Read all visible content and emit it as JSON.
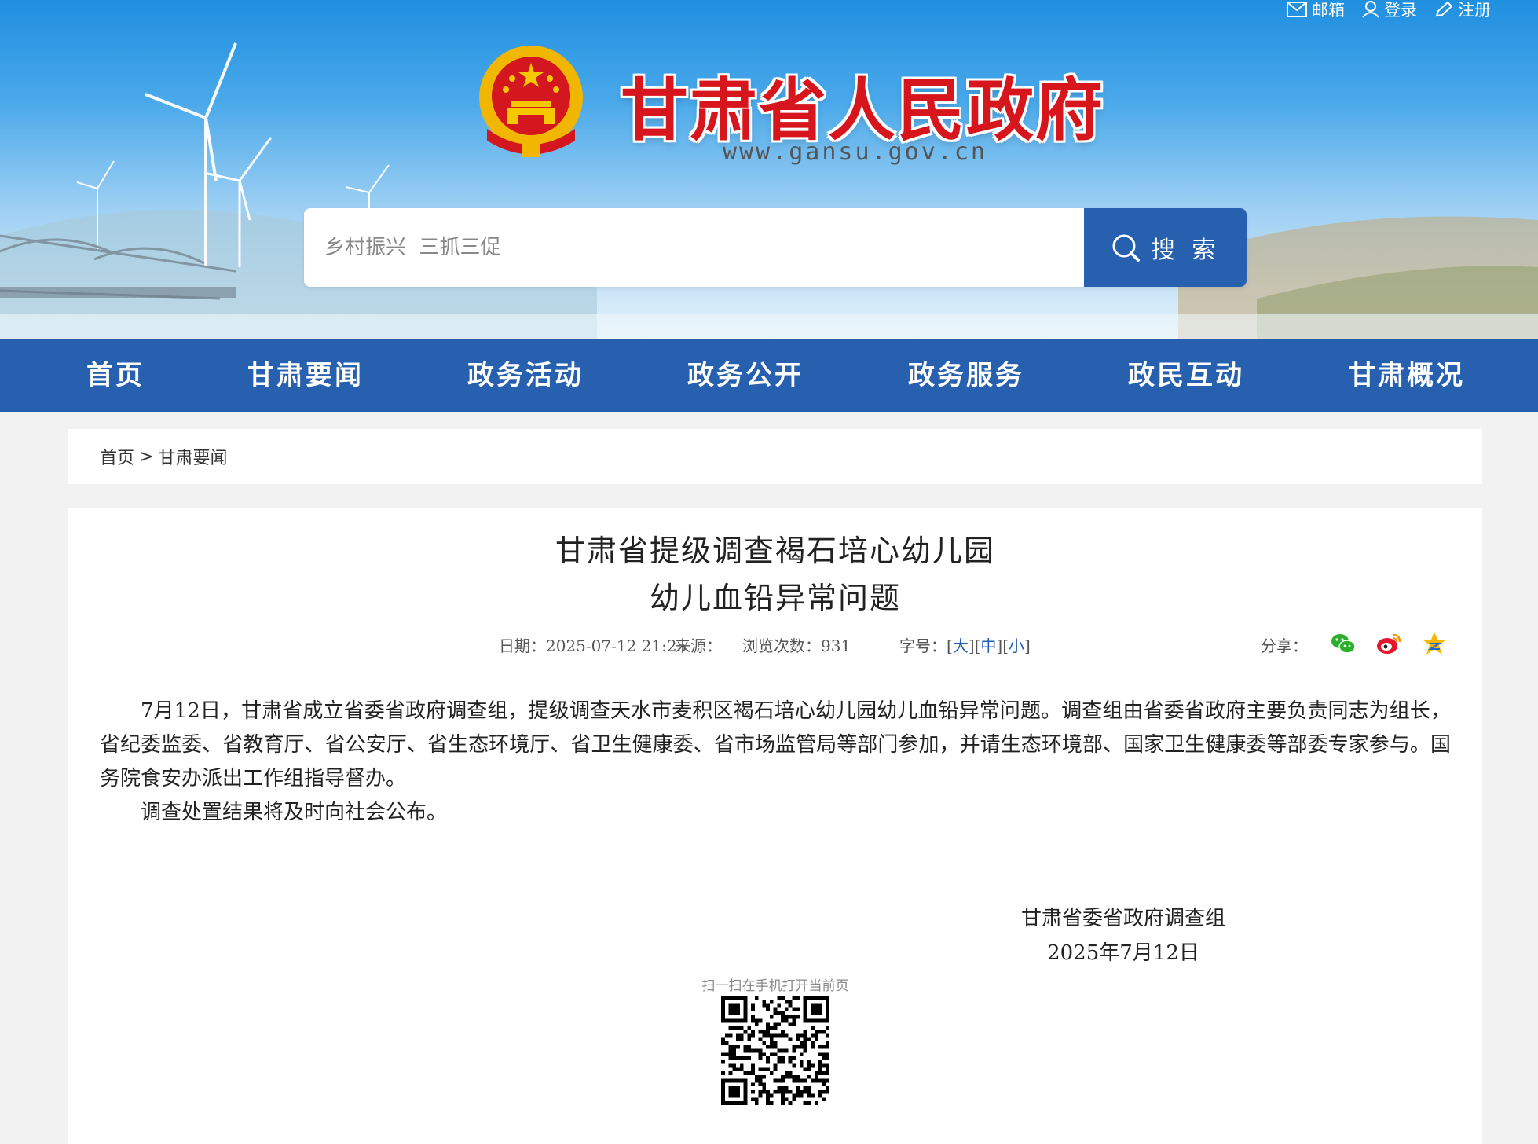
{
  "header": {
    "top_links": [
      {
        "label": "邮箱",
        "icon": "mail-icon"
      },
      {
        "label": "登录",
        "icon": "user-icon"
      },
      {
        "label": "注册",
        "icon": "pen-icon"
      }
    ],
    "site_title": "甘肃省人民政府",
    "site_url": "www.gansu.gov.cn",
    "search": {
      "placeholder": "乡村振兴  三抓三促",
      "button_label": "搜 索"
    }
  },
  "nav": {
    "items": [
      "首页",
      "甘肃要闻",
      "政务活动",
      "政务公开",
      "政务服务",
      "政民互动",
      "甘肃概况"
    ]
  },
  "breadcrumb": {
    "home": "首页",
    "separator": ">",
    "current": "甘肃要闻"
  },
  "article": {
    "title_line1": "甘肃省提级调查褐石培心幼儿园",
    "title_line2": "幼儿血铅异常问题",
    "meta": {
      "date_label": "日期：",
      "date": "2025-07-12 21:25",
      "source_label": "来源：",
      "views_label": "浏览次数：",
      "views": "931",
      "font_size_label": "字号：",
      "font_sizes": [
        "大",
        "中",
        "小"
      ],
      "share_label": "分享："
    },
    "paragraphs": [
      "7月12日，甘肃省成立省委省政府调查组，提级调查天水市麦积区褐石培心幼儿园幼儿血铅异常问题。调查组由省委省政府主要负责同志为组长，省纪委监委、省教育厅、省公安厅、省生态环境厅、省卫生健康委、省市场监管局等部门参加，并请生态环境部、国家卫生健康委等部委专家参与。国务院食安办派出工作组指导督办。",
      "调查处置结果将及时向社会公布。"
    ],
    "signature": "甘肃省委省政府调查组",
    "sign_date": "2025年7月12日",
    "qr_caption": "扫一扫在手机打开当前页"
  },
  "colors": {
    "nav_blue": "#2760ae",
    "search_button": "#2860b0",
    "title_red": "#d6151c",
    "link_blue": "#1f5fb4"
  }
}
